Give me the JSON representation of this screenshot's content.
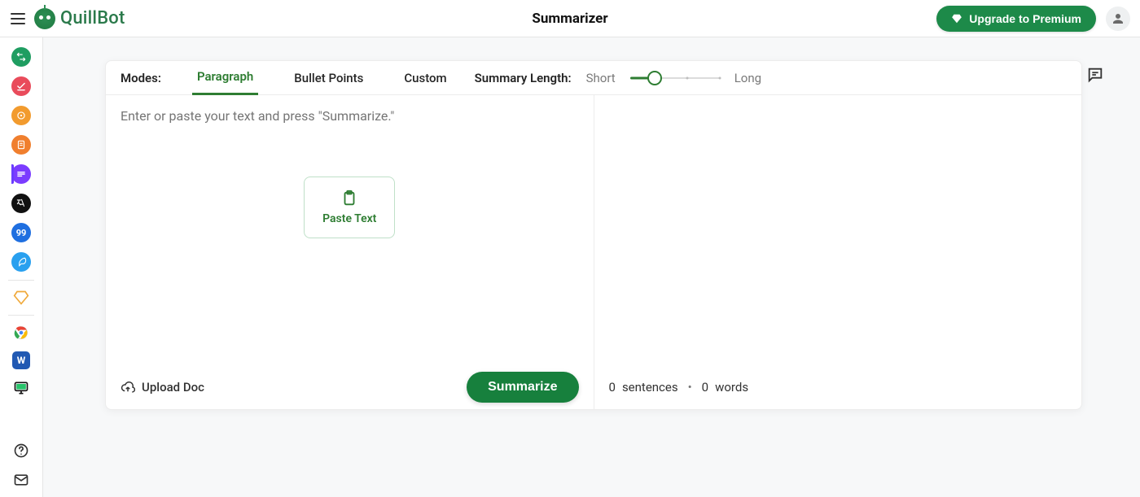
{
  "app": {
    "brand": "QuillBot",
    "page_title": "Summarizer"
  },
  "header": {
    "upgrade_label": "Upgrade to Premium"
  },
  "rail": {
    "items": [
      {
        "id": "paraphraser",
        "color": "#1f9d61",
        "kind": "circle"
      },
      {
        "id": "grammar",
        "color": "#e94b5b",
        "kind": "circle"
      },
      {
        "id": "plagiarism",
        "color": "#f29b2e",
        "kind": "circle"
      },
      {
        "id": "cowriter",
        "color": "#f07f2e",
        "kind": "circle"
      },
      {
        "id": "summarizer",
        "color": "#7b3cff",
        "kind": "circle",
        "active": true
      },
      {
        "id": "translator",
        "color": "#111111",
        "kind": "circle"
      },
      {
        "id": "citation",
        "color": "#1f6fe0",
        "kind": "circle",
        "glyph": "99"
      },
      {
        "id": "notes",
        "color": "#29a0ef",
        "kind": "circle"
      }
    ],
    "premium_color": "#f0a93a",
    "integrations": [
      {
        "id": "chrome"
      },
      {
        "id": "word"
      },
      {
        "id": "macos"
      }
    ]
  },
  "toolbar": {
    "modes_label": "Modes:",
    "tabs": [
      {
        "id": "paragraph",
        "label": "Paragraph",
        "active": true
      },
      {
        "id": "bullet",
        "label": "Bullet Points"
      },
      {
        "id": "custom",
        "label": "Custom"
      }
    ],
    "length_label": "Summary Length:",
    "length_short": "Short",
    "length_long": "Long"
  },
  "input": {
    "placeholder": "Enter or paste your text and press \"Summarize.\"",
    "paste_label": "Paste Text",
    "upload_label": "Upload Doc",
    "summarize_label": "Summarize"
  },
  "output": {
    "sentences_count": 0,
    "sentences_word": "sentences",
    "words_count": 0,
    "words_word": "words"
  }
}
